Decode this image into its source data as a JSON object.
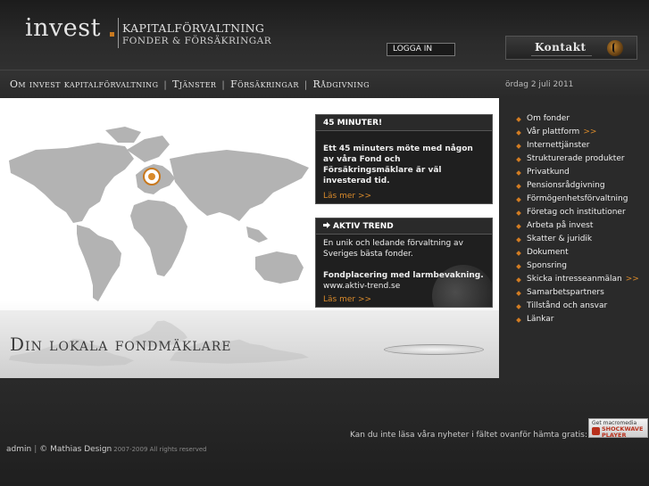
{
  "header": {
    "logo_word": "invest",
    "logo_line1": "KAPITALFÖRVALTNING",
    "logo_line2": "FONDER & FÖRSÄKRINGAR",
    "login_label": "LOGGA IN",
    "contact_label": "Kontakt"
  },
  "nav": {
    "items": [
      "Om invest kapitalförvaltning",
      "Tjänster",
      "Försäkringar",
      "Rådgivning"
    ],
    "date": "ördag 2 juli 2011"
  },
  "stage": {
    "tagline": "Din lokala fondmäklare"
  },
  "cards": [
    {
      "title": "45 MINUTER!",
      "body": "Ett 45 minuters möte med någon av våra Fond och Försäkringsmäklare är väl investerad tid.",
      "more": "Läs mer >>"
    },
    {
      "title": "AKTIV TREND",
      "body": "En unik och ledande förvaltning av Sveriges bästa fonder.",
      "bold": "Fondplacering med larmbevakning.",
      "url": "www.aktiv-trend.se",
      "more": "Läs mer >>"
    }
  ],
  "sidebar": {
    "items": [
      {
        "label": "Om fonder"
      },
      {
        "label": "Vår plattform",
        "more": ">>"
      },
      {
        "label": "Internettjänster"
      },
      {
        "label": "Strukturerade produkter"
      },
      {
        "label": "Privatkund"
      },
      {
        "label": "Pensionsrådgivning"
      },
      {
        "label": "Förmögenhetsförvaltning"
      },
      {
        "label": "Företag och institutioner"
      },
      {
        "label": "Arbeta på invest"
      },
      {
        "label": "Skatter & juridik"
      },
      {
        "label": "Dokument"
      },
      {
        "label": "Sponsring"
      },
      {
        "label": "Skicka intresseanmälan",
        "more": ">>"
      },
      {
        "label": "Samarbetspartners"
      },
      {
        "label": "Tillstånd och ansvar"
      },
      {
        "label": "Länkar"
      }
    ]
  },
  "footer": {
    "shockwave_text": "Kan du inte läsa våra nyheter i fältet ovanför hämta gratis:",
    "badge_line1": "Get macromedia",
    "badge_line2": "SHOCKWAVE",
    "badge_line3": "PLAYER",
    "admin": "admin",
    "copyright": "© Mathias Design",
    "years": "2007-2009 All rights reserved"
  },
  "colors": {
    "accent": "#d98a2b",
    "background": "#262626",
    "panel": "#1f1f1f"
  },
  "icons": [
    "phone-icon",
    "arrow-right-icon",
    "world-map",
    "location-marker-icon",
    "bullet-icon"
  ]
}
